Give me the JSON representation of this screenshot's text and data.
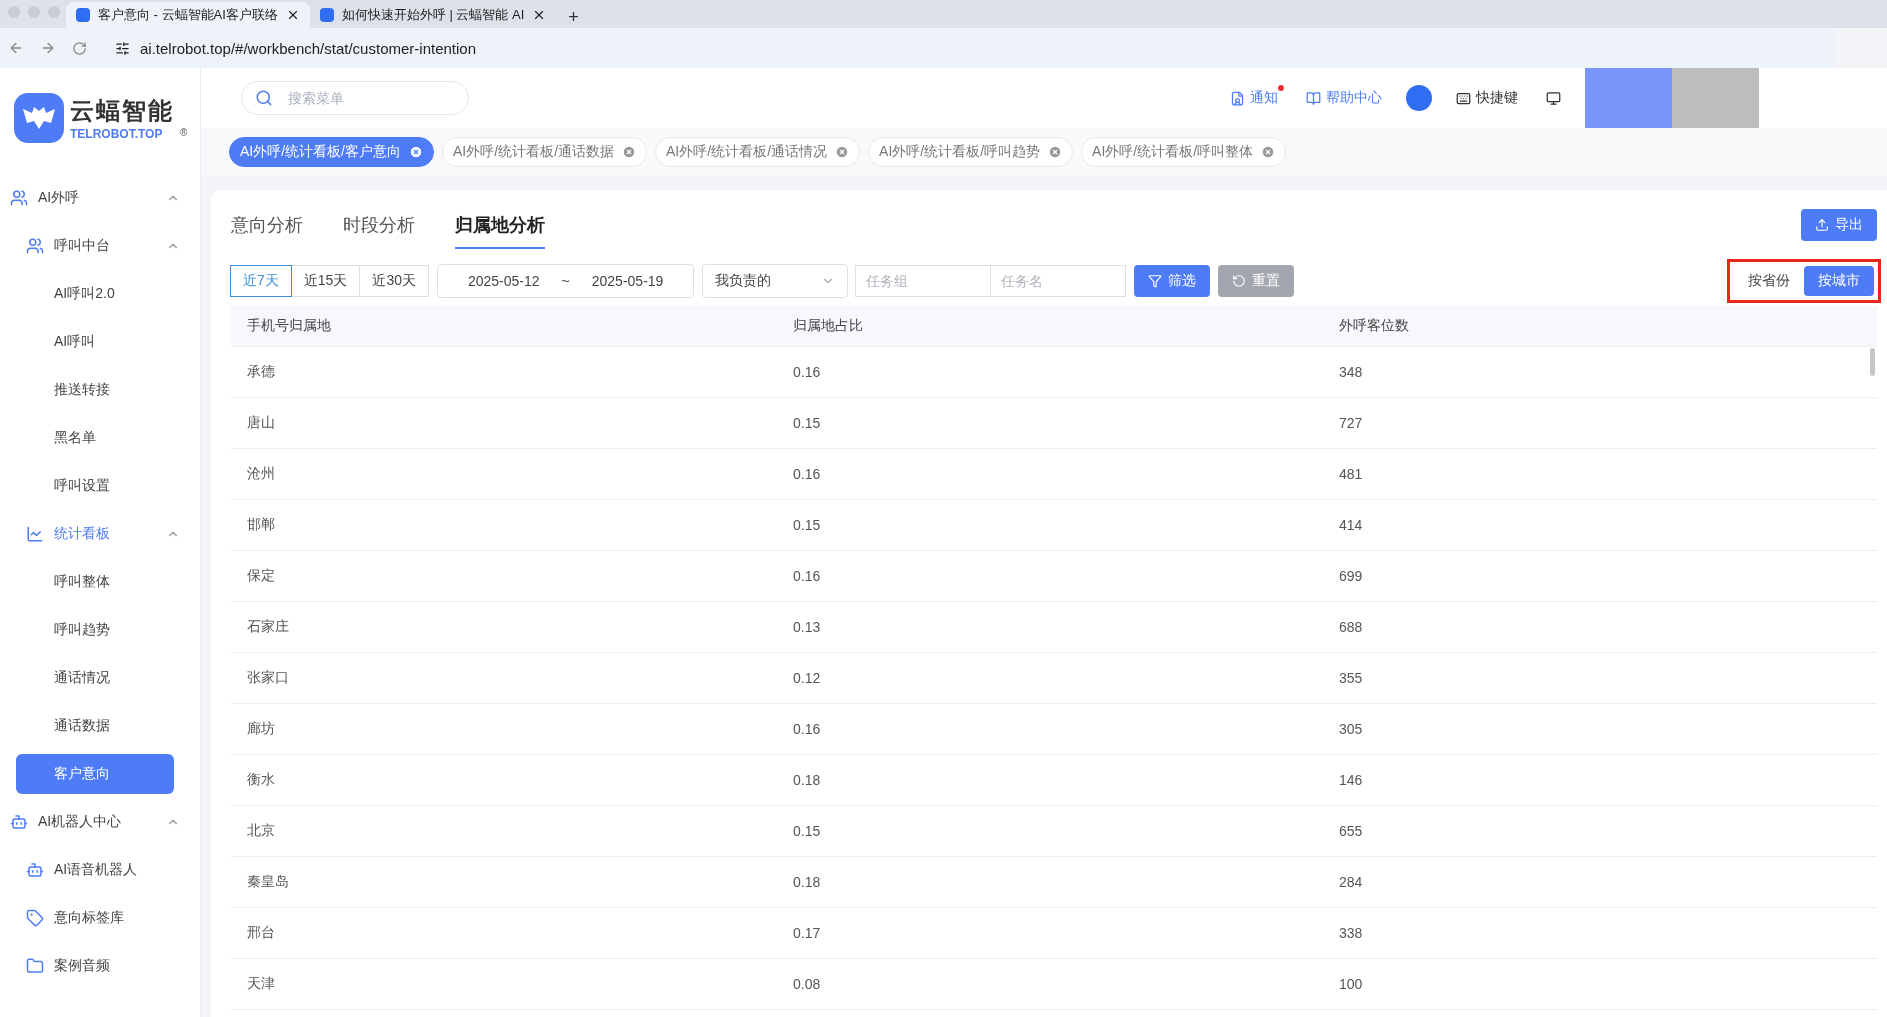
{
  "browser": {
    "tabs": [
      {
        "title": "客户意向 - 云蝠智能AI客户联络",
        "selected": true
      },
      {
        "title": "如何快速开始外呼 | 云蝠智能 AI",
        "selected": false
      }
    ],
    "new_tab": "+",
    "url": "ai.telrobot.top/#/workbench/stat/customer-intention"
  },
  "logo": {
    "name": "云蝠智能",
    "sub": "TELROBOT.TOP",
    "mark": "®"
  },
  "search": {
    "placeholder": "搜索菜单"
  },
  "header_actions": [
    {
      "kind": "notify",
      "label": "通知",
      "unread": true
    },
    {
      "kind": "help",
      "label": "帮助中心"
    },
    {
      "kind": "avatar"
    },
    {
      "kind": "keys",
      "label": "快捷键"
    },
    {
      "kind": "screen"
    }
  ],
  "open_pages": [
    {
      "label": "AI外呼/统计看板/客户意向",
      "selected": true
    },
    {
      "label": "AI外呼/统计看板/通话数据",
      "selected": false
    },
    {
      "label": "AI外呼/统计看板/通话情况",
      "selected": false
    },
    {
      "label": "AI外呼/统计看板/呼叫趋势",
      "selected": false
    },
    {
      "label": "AI外呼/统计看板/呼叫整体",
      "selected": false
    }
  ],
  "sidebar": {
    "items": [
      {
        "label": "AI外呼",
        "kind": "people",
        "expanded": true,
        "children": [
          {
            "label": "呼叫中台",
            "kind": "people",
            "expanded": true,
            "children": [
              {
                "label": "AI呼叫2.0",
                "selected": false
              },
              {
                "label": "AI呼叫",
                "selected": false
              },
              {
                "label": "推送转接",
                "selected": false
              },
              {
                "label": "黑名单",
                "selected": false
              },
              {
                "label": "呼叫设置",
                "selected": false
              }
            ]
          },
          {
            "label": "统计看板",
            "kind": "chart",
            "expanded": true,
            "children": [
              {
                "label": "呼叫整体",
                "selected": false
              },
              {
                "label": "呼叫趋势",
                "selected": false
              },
              {
                "label": "通话情况",
                "selected": false
              },
              {
                "label": "通话数据",
                "selected": false
              },
              {
                "label": "客户意向",
                "selected": true
              }
            ]
          }
        ]
      },
      {
        "label": "AI机器人中心",
        "kind": "bot",
        "expanded": true,
        "children": [
          {
            "label": "AI语音机器人",
            "kind": "bot"
          },
          {
            "label": "意向标签库",
            "kind": "tag"
          },
          {
            "label": "案例音频",
            "kind": "folder"
          }
        ]
      }
    ]
  },
  "analysis_tabs": [
    {
      "label": "意向分析",
      "selected": false
    },
    {
      "label": "时段分析",
      "selected": false
    },
    {
      "label": "归属地分析",
      "selected": true
    }
  ],
  "export_button": "导出",
  "ranges": [
    {
      "label": "近7天",
      "selected": true
    },
    {
      "label": "近15天",
      "selected": false
    },
    {
      "label": "近30天",
      "selected": false
    }
  ],
  "date_range": {
    "start": "2025-05-12",
    "separator": "~",
    "end": "2025-05-19"
  },
  "owner_select": {
    "value": "我负责的"
  },
  "task_group": {
    "placeholder": "任务组"
  },
  "task_name": {
    "placeholder": "任务名"
  },
  "filter_button": "筛选",
  "reset_button": "重置",
  "group_by": {
    "highlighted": true,
    "options": [
      {
        "label": "按省份",
        "selected": false
      },
      {
        "label": "按城市",
        "selected": true
      }
    ]
  },
  "table": {
    "columns": [
      "手机号归属地",
      "归属地占比",
      "外呼客位数"
    ],
    "rows": [
      [
        "承德",
        "0.16",
        "348"
      ],
      [
        "唐山",
        "0.15",
        "727"
      ],
      [
        "沧州",
        "0.16",
        "481"
      ],
      [
        "邯郸",
        "0.15",
        "414"
      ],
      [
        "保定",
        "0.16",
        "699"
      ],
      [
        "石家庄",
        "0.13",
        "688"
      ],
      [
        "张家口",
        "0.12",
        "355"
      ],
      [
        "廊坊",
        "0.16",
        "305"
      ],
      [
        "衡水",
        "0.18",
        "146"
      ],
      [
        "北京",
        "0.15",
        "655"
      ],
      [
        "秦皇岛",
        "0.18",
        "284"
      ],
      [
        "邢台",
        "0.17",
        "338"
      ],
      [
        "天津",
        "0.08",
        "100"
      ]
    ]
  }
}
